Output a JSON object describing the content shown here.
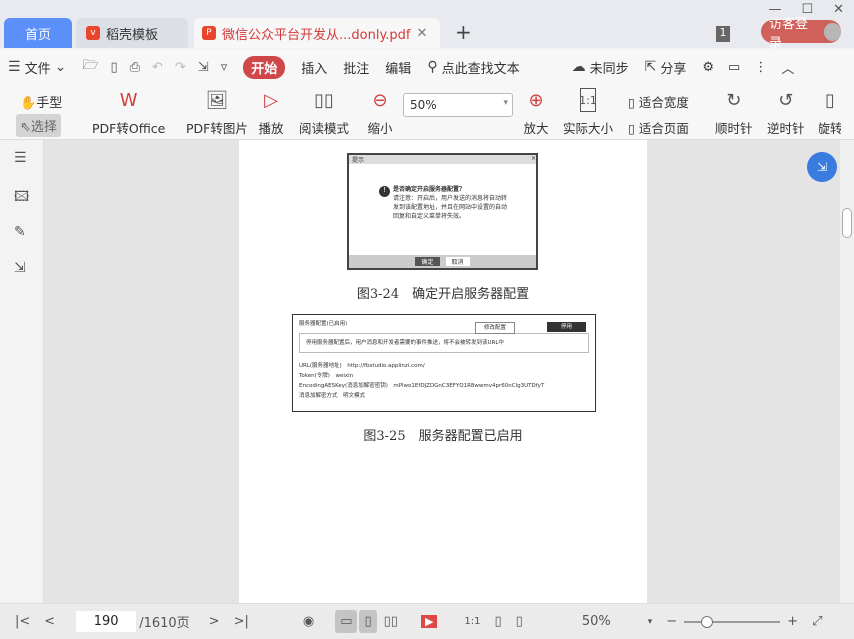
{
  "tabs": {
    "home": "首页",
    "template": "稻壳模板",
    "document": "微信公众平台开发从...donly.pdf"
  },
  "window": {
    "badge": "1",
    "login": "访客登录"
  },
  "menu": {
    "file": "文件",
    "start": "开始",
    "insert": "插入",
    "annotate": "批注",
    "edit": "编辑",
    "search": "点此查找文本",
    "sync": "未同步",
    "share": "分享"
  },
  "tools": {
    "hand": "手型",
    "select": "选择",
    "pdf_office": "PDF转Office",
    "pdf_image": "PDF转图片",
    "play": "播放",
    "read_mode": "阅读模式",
    "zoom_out": "缩小",
    "zoom_value": "50%",
    "zoom_in": "放大",
    "actual_size": "实际大小",
    "fit_width": "适合宽度",
    "fit_page": "适合页面",
    "clockwise": "顺时针",
    "counter": "逆时针",
    "rotate": "旋转"
  },
  "doc": {
    "dialog": {
      "title": "提示",
      "question": "是否确定开启服务器配置？",
      "note": "请注意：开启后，用户发送的消息将自动转发到该配置地址，并且在网站中设置的自动回复和自定义菜单将失效。",
      "ok": "确定",
      "cancel": "取消"
    },
    "caption1": "图3-24　确定开启服务器配置",
    "panel": {
      "title": "服务器配置(已启用)",
      "modify": "修改配置",
      "disable": "停用",
      "notice": "停用服务器配置后，用户消息和开发者需要的事件推送，将不会被转发到该URL中",
      "url": "URL(服务器地址)　http://fbstudio.applinzi.com/",
      "token": "Token(令牌)　weixin",
      "aes": "EncodingAESKey(消息加解密密钥)　mPlwo1EfDJZDGnC3EFYQ1R8wwmv4pr60nClg3UTDfyT",
      "mode": "消息加解密方式　明文模式"
    },
    "caption2": "图3-25　服务器配置已启用"
  },
  "status": {
    "page": "190",
    "total": "/1610页",
    "zoom": "50%"
  }
}
